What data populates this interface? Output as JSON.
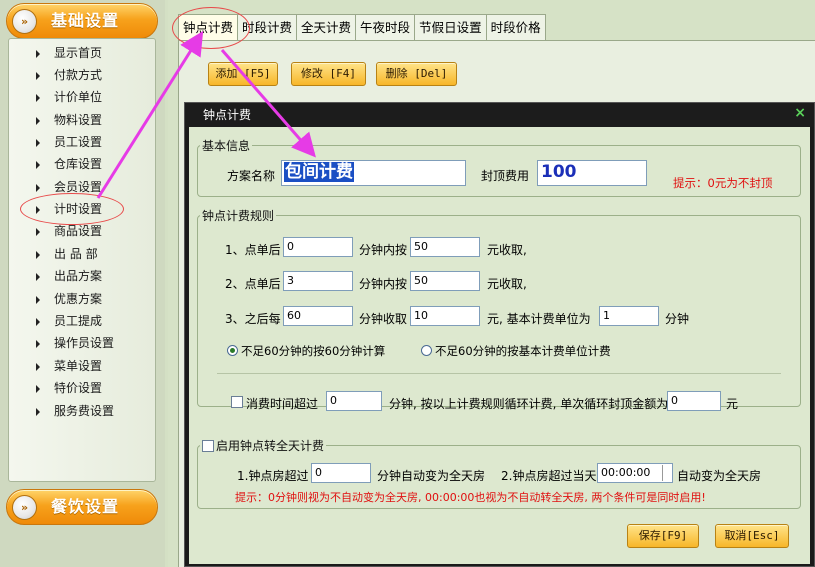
{
  "sidebar": {
    "header_top": "基础设置",
    "header_bottom": "餐饮设置",
    "items": [
      {
        "label": "显示首页"
      },
      {
        "label": "付款方式"
      },
      {
        "label": "计价单位"
      },
      {
        "label": "物料设置"
      },
      {
        "label": "员工设置"
      },
      {
        "label": "仓库设置"
      },
      {
        "label": "会员设置"
      },
      {
        "label": "计时设置"
      },
      {
        "label": "商品设置"
      },
      {
        "label": "出 品 部"
      },
      {
        "label": "出品方案"
      },
      {
        "label": "优惠方案"
      },
      {
        "label": "员工提成"
      },
      {
        "label": "操作员设置"
      },
      {
        "label": "菜单设置"
      },
      {
        "label": "特价设置"
      },
      {
        "label": "服务费设置"
      }
    ]
  },
  "tabs": [
    "钟点计费",
    "时段计费",
    "全天计费",
    "午夜时段",
    "节假日设置",
    "时段价格"
  ],
  "toolbar": {
    "add": "添加 [F5]",
    "edit": "修改 [F4]",
    "delete": "删除 [Del]"
  },
  "dialog": {
    "title": "钟点计费",
    "close": "×",
    "basic": {
      "legend": "基本信息",
      "name_label": "方案名称",
      "name_value": "包间计费",
      "cap_label": "封顶费用",
      "cap_value": "100",
      "hint": "提示：0元为不封顶"
    },
    "rules": {
      "legend": "钟点计费规则",
      "row1": {
        "prefix": "1、点单后",
        "v1": "0",
        "mid": "分钟内按",
        "v2": "50",
        "suffix": "元收取,"
      },
      "row2": {
        "prefix": "2、点单后",
        "v1": "3",
        "mid": "分钟内按",
        "v2": "50",
        "suffix": "元收取,"
      },
      "row3": {
        "prefix": "3、之后每",
        "v1": "60",
        "mid": "分钟收取",
        "v2": "10",
        "suffix": "元, 基本计费单位为",
        "v3": "1",
        "unit": "分钟"
      },
      "radio1": "不足60分钟的按60分钟计算",
      "radio2": "不足60分钟的按基本计费单位计费",
      "loop_label": "消费时间超过",
      "loop_v1": "0",
      "loop_mid": "分钟, 按以上计费规则循环计费, 单次循环封顶金额为",
      "loop_v2": "0",
      "loop_unit": "元"
    },
    "allday": {
      "legend": "启用钟点转全天计费",
      "c1_prefix": "1.钟点房超过",
      "c1_value": "0",
      "c1_suffix": "分钟自动变为全天房",
      "c2_prefix": "2.钟点房超过当天",
      "c2_value": "00:00:00",
      "c2_suffix": "自动变为全天房",
      "hint": "提示：0分钟则视为不自动变为全天房, 00:00:00也视为不自动转全天房, 两个条件可是同时启用!"
    },
    "save": "保存[F9]",
    "cancel": "取消[Esc]"
  },
  "colors": {
    "accent_orange": "#f7a21c",
    "annotation_magenta": "#e63be6",
    "annotation_red": "#e84a4a",
    "hint_red": "#e01010"
  }
}
